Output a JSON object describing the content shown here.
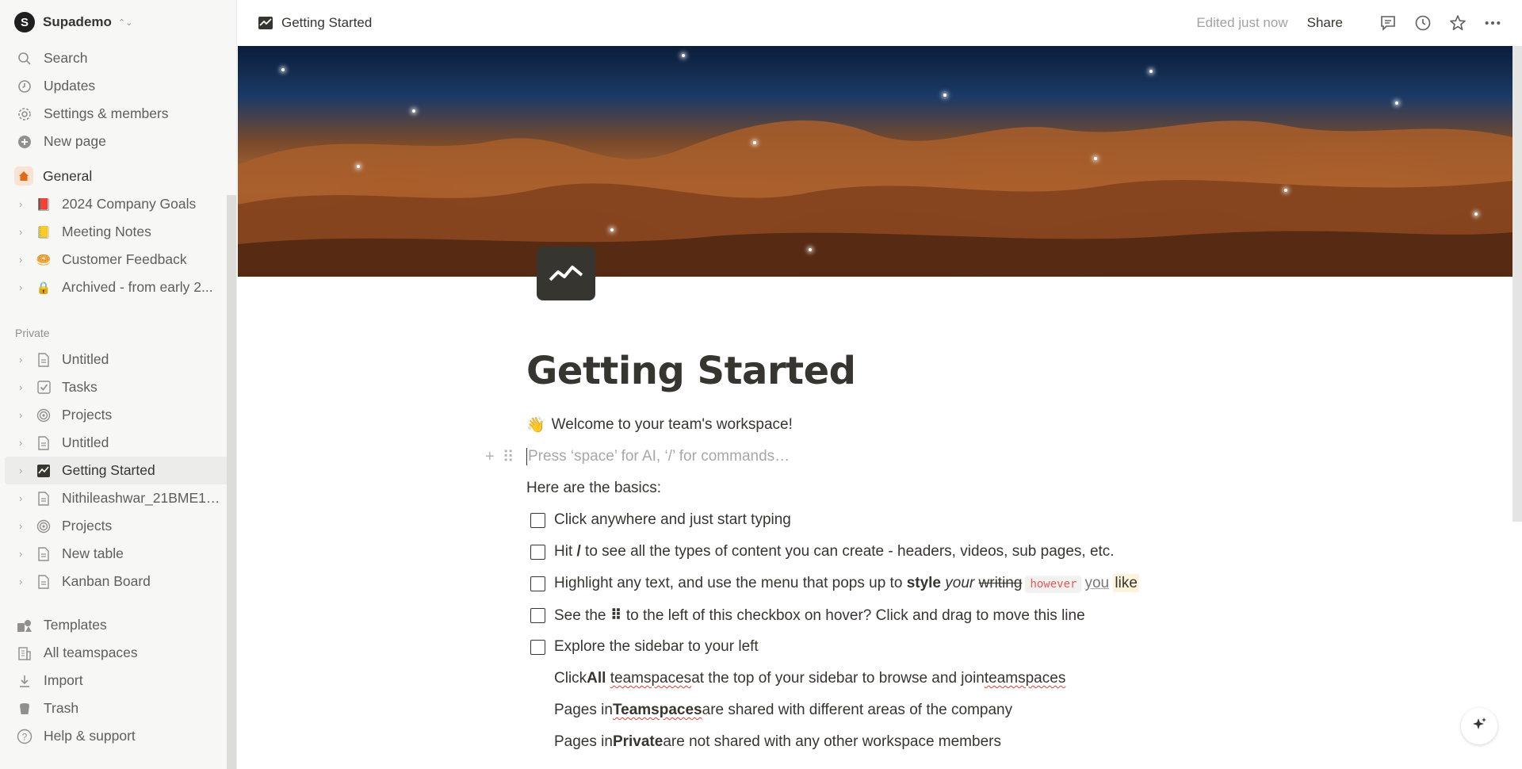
{
  "workspace": {
    "initial": "S",
    "name": "Supademo"
  },
  "sidebar": {
    "top_items": [
      {
        "label": "Search",
        "icon": "search-icon"
      },
      {
        "label": "Updates",
        "icon": "clock-icon"
      },
      {
        "label": "Settings & members",
        "icon": "gear-icon"
      },
      {
        "label": "New page",
        "icon": "plus-circle-icon"
      }
    ],
    "general": {
      "label": "General",
      "icon": "home-icon"
    },
    "teamspace_pages": [
      {
        "label": "2024 Company Goals",
        "icon": "📕"
      },
      {
        "label": "Meeting Notes",
        "icon": "📒"
      },
      {
        "label": "Customer Feedback",
        "icon": "🥯"
      },
      {
        "label": "Archived - from early 2...",
        "icon": "🔒"
      }
    ],
    "private_label": "Private",
    "private_pages": [
      {
        "label": "Untitled",
        "icon": "page-icon"
      },
      {
        "label": "Tasks",
        "icon": "checkbox-icon"
      },
      {
        "label": "Projects",
        "icon": "target-icon"
      },
      {
        "label": "Untitled",
        "icon": "page-icon"
      },
      {
        "label": "Getting Started",
        "icon": "chart-icon",
        "active": true
      },
      {
        "label": "Nithileashwar_21BME10...",
        "icon": "page-icon"
      },
      {
        "label": "Projects",
        "icon": "target-icon"
      },
      {
        "label": "New table",
        "icon": "page-icon"
      },
      {
        "label": "Kanban Board",
        "icon": "page-icon"
      }
    ],
    "bottom_items": [
      {
        "label": "Templates",
        "icon": "templates-icon"
      },
      {
        "label": "All teamspaces",
        "icon": "building-icon"
      },
      {
        "label": "Import",
        "icon": "download-icon"
      },
      {
        "label": "Trash",
        "icon": "trash-icon"
      },
      {
        "label": "Help & support",
        "icon": "help-icon"
      }
    ]
  },
  "topbar": {
    "breadcrumb": "Getting Started",
    "edited": "Edited just now",
    "share": "Share"
  },
  "page": {
    "title": "Getting Started",
    "welcome_emoji": "👋",
    "welcome": "Welcome to your team's workspace!",
    "placeholder": "Press ‘space’ for AI, ‘/’ for commands…",
    "basics": "Here are the basics:",
    "todos": {
      "t1": "Click anywhere and just start typing",
      "t2_a": "Hit ",
      "t2_b": "/",
      "t2_c": " to see all the types of content you can create - headers, videos, sub pages, etc.",
      "t3_a": "Highlight any text, and use the menu that pops up to ",
      "t3_style": "style",
      "t3_your": "your",
      "t3_writing": "writing",
      "t3_however": "however",
      "t3_you": "you",
      "t3_like": "like",
      "t4_a": "See the ",
      "t4_b": "⠿",
      "t4_c": " to the left of this checkbox on hover? Click and drag to move this line",
      "t5": "Explore the sidebar to your left"
    },
    "sub": {
      "s1_a": "Click ",
      "s1_b": "All",
      "s1_c": "teamspaces",
      "s1_d": " at the top of your sidebar to browse and join ",
      "s1_e": "teamspaces",
      "s2_a": "Pages in ",
      "s2_b": "Teamspaces",
      "s2_c": " are shared with different areas of the company",
      "s3_a": "Pages in ",
      "s3_b": "Private",
      "s3_c": " are not shared with any other workspace members"
    }
  },
  "colors": {
    "sidebar_bg": "#f7f7f5",
    "text": "#37352f",
    "muted": "#91908c",
    "code_red": "#eb5757"
  }
}
